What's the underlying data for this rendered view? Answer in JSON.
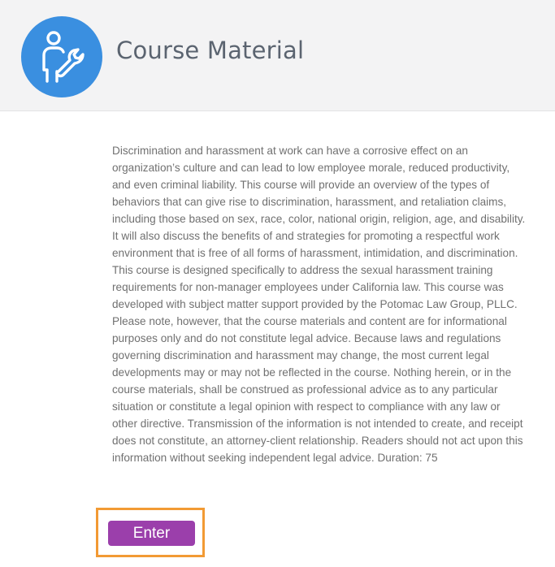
{
  "header": {
    "title": "Course Material",
    "icon": "user-wrench-icon",
    "accent_color": "#3a8fe0"
  },
  "main": {
    "description": "Discrimination and harassment at work can have a corrosive effect on an organization’s culture and can lead to low employee morale, reduced productivity, and even criminal liability. This course will provide an overview of the types of behaviors that can give rise to discrimination, harassment, and retaliation claims, including those based on sex, race, color, national origin, religion, age, and disability. It will also discuss the benefits of and strategies for promoting a respectful work environment that is free of all forms of harassment, intimidation, and discrimination. This course is designed specifically to address the sexual harassment training requirements for non-manager employees under California law. This course was developed with subject matter support provided by the Potomac Law Group, PLLC. Please note, however, that the course materials and content are for informational purposes only and do not constitute legal advice. Because laws and regulations governing discrimination and harassment may change, the most current legal developments may or may not be reflected in the course. Nothing herein, or in the course materials, shall be construed as professional advice as to any particular situation or constitute a legal opinion with respect to compliance with any law or other directive. Transmission of the information is not intended to create, and receipt does not constitute, an attorney-client relationship. Readers should not act upon this information without seeking independent legal advice. Duration: 75",
    "enter_label": "Enter",
    "enter_color": "#9b3fab",
    "highlight_color": "#f29a34"
  }
}
